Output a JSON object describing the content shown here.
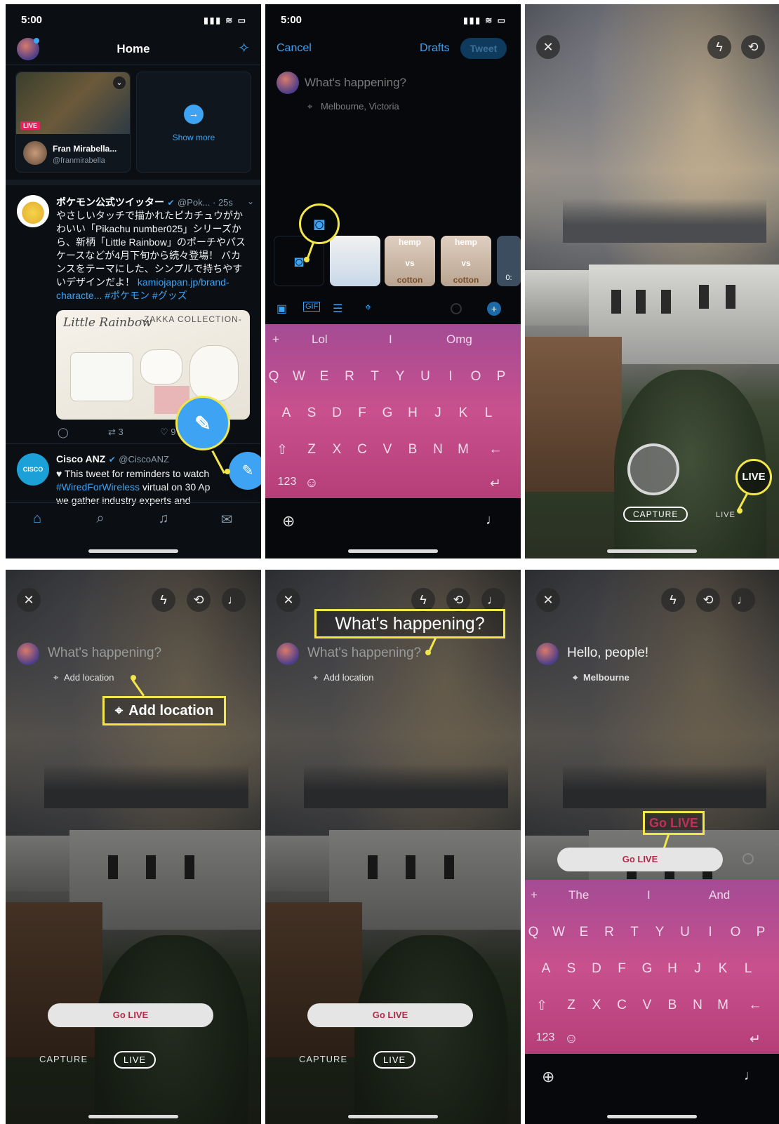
{
  "colors": {
    "callout": "#f2e64a",
    "twitter_blue": "#3ea3f2",
    "go_live_text": "#b02a4a",
    "keyboard": "#c8508d"
  },
  "panel1": {
    "time": "5:00",
    "header_title": "Home",
    "live_badge": "LIVE",
    "live_user_name": "Fran Mirabella...",
    "live_user_handle": "@franmirabella",
    "show_more": "Show more",
    "tweet1": {
      "name": "ポケモン公式ツイッター",
      "meta": "@Pok... · 25s",
      "text": "やさしいタッチで描かれたピカチュウがかわいい「Pikachu number025」シリーズから、新柄「Little Rainbow」のポーチやパスケースなどが4月下旬から続々登場！ バカンスをテーマにした、シンプルで持ちやすいデザインだよ！",
      "link": "kamiojapan.jp/brand-characte... #ポケモン #グッズ",
      "image_title": "-ZAKKA COLLECTION-",
      "image_brand": "Little Rainbow",
      "retweets": "3",
      "likes": "9"
    },
    "tweet2": {
      "name": "Cisco ANZ",
      "handle": "@CiscoANZ",
      "line1": "♥ This tweet for reminders to watch",
      "hashtag": "#WiredForWireless",
      "line2": " virtual on 30 Ap",
      "line3": "we gather industry experts and",
      "avatar_text": "CISCO"
    }
  },
  "panel2": {
    "time": "5:00",
    "cancel": "Cancel",
    "drafts": "Drafts",
    "tweet_btn": "Tweet",
    "placeholder": "What's happening?",
    "location": "Melbourne, Victoria",
    "thumb_hemp": "hemp",
    "thumb_vs": "vs",
    "thumb_cotton": "cotton",
    "thumb_edge": "0:",
    "suggestions": [
      "Lol",
      "I",
      "Omg"
    ],
    "keys_row1": [
      "Q",
      "W",
      "E",
      "R",
      "T",
      "Y",
      "U",
      "I",
      "O",
      "P"
    ],
    "keys_row2": [
      "A",
      "S",
      "D",
      "F",
      "G",
      "H",
      "J",
      "K",
      "L"
    ],
    "keys_row3": [
      "Z",
      "X",
      "C",
      "V",
      "B",
      "N",
      "M"
    ],
    "key_123": "123",
    "key_plus": "+"
  },
  "panel3": {
    "capture": "CAPTURE",
    "live": "LIVE",
    "callout_live": "LIVE"
  },
  "panel4": {
    "placeholder": "What's happening?",
    "add_location": "Add location",
    "callout_add_location": "Add location",
    "go_live": "Go LIVE",
    "capture": "CAPTURE",
    "live": "LIVE"
  },
  "panel5": {
    "placeholder": "What's happening?",
    "callout_whats_happening": "What's happening?",
    "add_location": "Add location",
    "go_live": "Go LIVE",
    "capture": "CAPTURE",
    "live": "LIVE"
  },
  "panel6": {
    "tweet_text": "Hello, people!",
    "location": "Melbourne",
    "callout_go_live": "Go LIVE",
    "go_live": "Go LIVE",
    "suggestions": [
      "The",
      "I",
      "And"
    ],
    "keys_row1": [
      "Q",
      "W",
      "E",
      "R",
      "T",
      "Y",
      "U",
      "I",
      "O",
      "P"
    ],
    "keys_row2": [
      "A",
      "S",
      "D",
      "F",
      "G",
      "H",
      "J",
      "K",
      "L"
    ],
    "keys_row3": [
      "Z",
      "X",
      "C",
      "V",
      "B",
      "N",
      "M"
    ],
    "key_123": "123",
    "key_plus": "+"
  }
}
